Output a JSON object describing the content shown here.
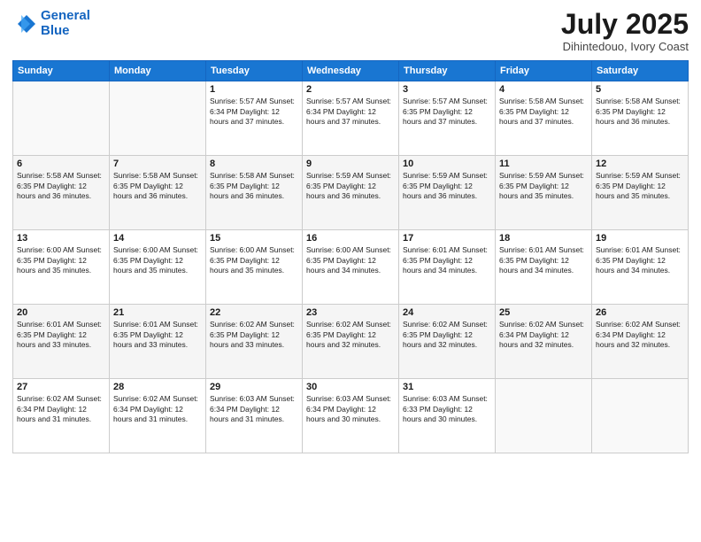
{
  "header": {
    "logo_line1": "General",
    "logo_line2": "Blue",
    "month": "July 2025",
    "location": "Dihintedouo, Ivory Coast"
  },
  "weekdays": [
    "Sunday",
    "Monday",
    "Tuesday",
    "Wednesday",
    "Thursday",
    "Friday",
    "Saturday"
  ],
  "weeks": [
    [
      {
        "day": "",
        "info": ""
      },
      {
        "day": "",
        "info": ""
      },
      {
        "day": "1",
        "info": "Sunrise: 5:57 AM\nSunset: 6:34 PM\nDaylight: 12 hours and 37 minutes."
      },
      {
        "day": "2",
        "info": "Sunrise: 5:57 AM\nSunset: 6:34 PM\nDaylight: 12 hours and 37 minutes."
      },
      {
        "day": "3",
        "info": "Sunrise: 5:57 AM\nSunset: 6:35 PM\nDaylight: 12 hours and 37 minutes."
      },
      {
        "day": "4",
        "info": "Sunrise: 5:58 AM\nSunset: 6:35 PM\nDaylight: 12 hours and 37 minutes."
      },
      {
        "day": "5",
        "info": "Sunrise: 5:58 AM\nSunset: 6:35 PM\nDaylight: 12 hours and 36 minutes."
      }
    ],
    [
      {
        "day": "6",
        "info": "Sunrise: 5:58 AM\nSunset: 6:35 PM\nDaylight: 12 hours and 36 minutes."
      },
      {
        "day": "7",
        "info": "Sunrise: 5:58 AM\nSunset: 6:35 PM\nDaylight: 12 hours and 36 minutes."
      },
      {
        "day": "8",
        "info": "Sunrise: 5:58 AM\nSunset: 6:35 PM\nDaylight: 12 hours and 36 minutes."
      },
      {
        "day": "9",
        "info": "Sunrise: 5:59 AM\nSunset: 6:35 PM\nDaylight: 12 hours and 36 minutes."
      },
      {
        "day": "10",
        "info": "Sunrise: 5:59 AM\nSunset: 6:35 PM\nDaylight: 12 hours and 36 minutes."
      },
      {
        "day": "11",
        "info": "Sunrise: 5:59 AM\nSunset: 6:35 PM\nDaylight: 12 hours and 35 minutes."
      },
      {
        "day": "12",
        "info": "Sunrise: 5:59 AM\nSunset: 6:35 PM\nDaylight: 12 hours and 35 minutes."
      }
    ],
    [
      {
        "day": "13",
        "info": "Sunrise: 6:00 AM\nSunset: 6:35 PM\nDaylight: 12 hours and 35 minutes."
      },
      {
        "day": "14",
        "info": "Sunrise: 6:00 AM\nSunset: 6:35 PM\nDaylight: 12 hours and 35 minutes."
      },
      {
        "day": "15",
        "info": "Sunrise: 6:00 AM\nSunset: 6:35 PM\nDaylight: 12 hours and 35 minutes."
      },
      {
        "day": "16",
        "info": "Sunrise: 6:00 AM\nSunset: 6:35 PM\nDaylight: 12 hours and 34 minutes."
      },
      {
        "day": "17",
        "info": "Sunrise: 6:01 AM\nSunset: 6:35 PM\nDaylight: 12 hours and 34 minutes."
      },
      {
        "day": "18",
        "info": "Sunrise: 6:01 AM\nSunset: 6:35 PM\nDaylight: 12 hours and 34 minutes."
      },
      {
        "day": "19",
        "info": "Sunrise: 6:01 AM\nSunset: 6:35 PM\nDaylight: 12 hours and 34 minutes."
      }
    ],
    [
      {
        "day": "20",
        "info": "Sunrise: 6:01 AM\nSunset: 6:35 PM\nDaylight: 12 hours and 33 minutes."
      },
      {
        "day": "21",
        "info": "Sunrise: 6:01 AM\nSunset: 6:35 PM\nDaylight: 12 hours and 33 minutes."
      },
      {
        "day": "22",
        "info": "Sunrise: 6:02 AM\nSunset: 6:35 PM\nDaylight: 12 hours and 33 minutes."
      },
      {
        "day": "23",
        "info": "Sunrise: 6:02 AM\nSunset: 6:35 PM\nDaylight: 12 hours and 32 minutes."
      },
      {
        "day": "24",
        "info": "Sunrise: 6:02 AM\nSunset: 6:35 PM\nDaylight: 12 hours and 32 minutes."
      },
      {
        "day": "25",
        "info": "Sunrise: 6:02 AM\nSunset: 6:34 PM\nDaylight: 12 hours and 32 minutes."
      },
      {
        "day": "26",
        "info": "Sunrise: 6:02 AM\nSunset: 6:34 PM\nDaylight: 12 hours and 32 minutes."
      }
    ],
    [
      {
        "day": "27",
        "info": "Sunrise: 6:02 AM\nSunset: 6:34 PM\nDaylight: 12 hours and 31 minutes."
      },
      {
        "day": "28",
        "info": "Sunrise: 6:02 AM\nSunset: 6:34 PM\nDaylight: 12 hours and 31 minutes."
      },
      {
        "day": "29",
        "info": "Sunrise: 6:03 AM\nSunset: 6:34 PM\nDaylight: 12 hours and 31 minutes."
      },
      {
        "day": "30",
        "info": "Sunrise: 6:03 AM\nSunset: 6:34 PM\nDaylight: 12 hours and 30 minutes."
      },
      {
        "day": "31",
        "info": "Sunrise: 6:03 AM\nSunset: 6:33 PM\nDaylight: 12 hours and 30 minutes."
      },
      {
        "day": "",
        "info": ""
      },
      {
        "day": "",
        "info": ""
      }
    ]
  ]
}
